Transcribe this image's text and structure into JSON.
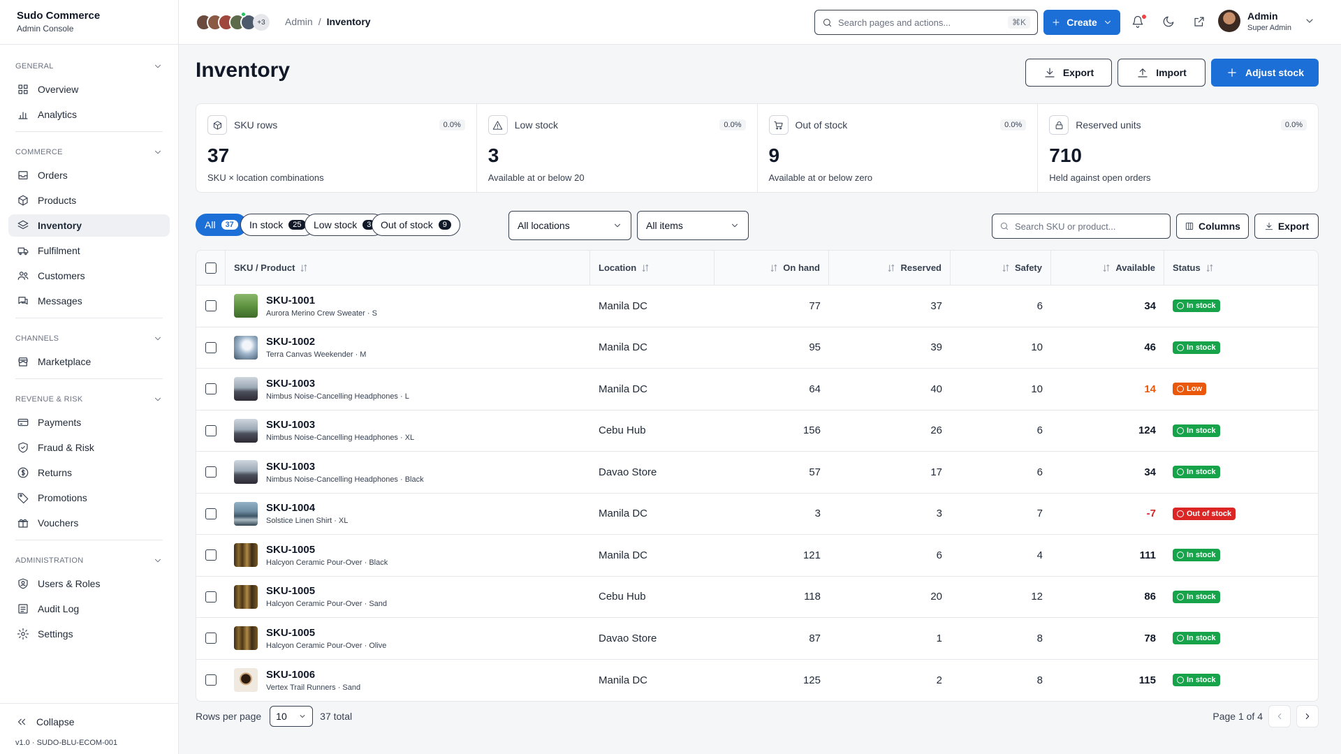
{
  "brand": {
    "name": "Sudo Commerce",
    "subtitle": "Admin Console"
  },
  "sidebar": {
    "sections": [
      {
        "title": "GENERAL",
        "items": [
          {
            "label": "Overview",
            "icon": "grid-icon"
          },
          {
            "label": "Analytics",
            "icon": "bar-chart-icon"
          }
        ]
      },
      {
        "title": "COMMERCE",
        "items": [
          {
            "label": "Orders",
            "icon": "inbox-icon"
          },
          {
            "label": "Products",
            "icon": "box-icon"
          },
          {
            "label": "Inventory",
            "icon": "layers-icon",
            "active": true
          },
          {
            "label": "Fulfilment",
            "icon": "truck-icon"
          },
          {
            "label": "Customers",
            "icon": "users-icon"
          },
          {
            "label": "Messages",
            "icon": "messages-icon"
          }
        ]
      },
      {
        "title": "CHANNELS",
        "items": [
          {
            "label": "Marketplace",
            "icon": "store-icon"
          }
        ]
      },
      {
        "title": "REVENUE & RISK",
        "items": [
          {
            "label": "Payments",
            "icon": "credit-card-icon"
          },
          {
            "label": "Fraud & Risk",
            "icon": "shield-icon"
          },
          {
            "label": "Returns",
            "icon": "dollar-circle-icon"
          },
          {
            "label": "Promotions",
            "icon": "tag-icon"
          },
          {
            "label": "Vouchers",
            "icon": "gift-icon"
          }
        ]
      },
      {
        "title": "ADMINISTRATION",
        "items": [
          {
            "label": "Users & Roles",
            "icon": "user-shield-icon"
          },
          {
            "label": "Audit Log",
            "icon": "list-icon"
          },
          {
            "label": "Settings",
            "icon": "gear-icon"
          }
        ]
      }
    ],
    "collapse_label": "Collapse",
    "version": "v1.0 · SUDO-BLU-ECOM-001"
  },
  "topbar": {
    "avatars_more": "+3",
    "breadcrumb": [
      "Admin",
      "Inventory"
    ],
    "search_placeholder": "Search pages and actions...",
    "search_shortcut": "⌘K",
    "create_label": "Create",
    "user": {
      "name": "Admin",
      "role": "Super Admin"
    }
  },
  "page": {
    "title": "Inventory",
    "actions": {
      "export": "Export",
      "import": "Import",
      "adjust": "Adjust stock"
    }
  },
  "stats": [
    {
      "label": "SKU rows",
      "pct": "0.0%",
      "value": "37",
      "sub": "SKU × location combinations",
      "icon": "cube-icon"
    },
    {
      "label": "Low stock",
      "pct": "0.0%",
      "value": "3",
      "sub": "Available at or below 20",
      "icon": "warning-icon"
    },
    {
      "label": "Out of stock",
      "pct": "0.0%",
      "value": "9",
      "sub": "Available at or below zero",
      "icon": "cart-icon"
    },
    {
      "label": "Reserved units",
      "pct": "0.0%",
      "value": "710",
      "sub": "Held against open orders",
      "icon": "lock-icon"
    }
  ],
  "filters": {
    "chips": [
      {
        "label": "All",
        "count": "37",
        "active": true
      },
      {
        "label": "In stock",
        "count": "25"
      },
      {
        "label": "Low stock",
        "count": "3"
      },
      {
        "label": "Out of stock",
        "count": "9"
      }
    ],
    "location": "All locations",
    "items": "All items",
    "search_placeholder": "Search SKU or product...",
    "columns_label": "Columns",
    "export_label": "Export"
  },
  "table": {
    "headers": {
      "sku": "SKU / Product",
      "location": "Location",
      "on_hand": "On hand",
      "reserved": "Reserved",
      "safety": "Safety",
      "available": "Available",
      "status": "Status"
    },
    "rows": [
      {
        "sku": "SKU-1001",
        "product": "Aurora Merino Crew Sweater · S",
        "location": "Manila DC",
        "on_hand": "77",
        "reserved": "37",
        "safety": "6",
        "available": "34",
        "status": "In stock",
        "state": "ok",
        "thumb": "green"
      },
      {
        "sku": "SKU-1002",
        "product": "Terra Canvas Weekender · M",
        "location": "Manila DC",
        "on_hand": "95",
        "reserved": "39",
        "safety": "10",
        "available": "46",
        "status": "In stock",
        "state": "ok",
        "thumb": "sky"
      },
      {
        "sku": "SKU-1003",
        "product": "Nimbus Noise-Cancelling Headphones · L",
        "location": "Manila DC",
        "on_hand": "64",
        "reserved": "40",
        "safety": "10",
        "available": "14",
        "status": "Low",
        "state": "low",
        "thumb": "mountain"
      },
      {
        "sku": "SKU-1003",
        "product": "Nimbus Noise-Cancelling Headphones · XL",
        "location": "Cebu Hub",
        "on_hand": "156",
        "reserved": "26",
        "safety": "6",
        "available": "124",
        "status": "In stock",
        "state": "ok",
        "thumb": "mountain"
      },
      {
        "sku": "SKU-1003",
        "product": "Nimbus Noise-Cancelling Headphones · Black",
        "location": "Davao Store",
        "on_hand": "57",
        "reserved": "17",
        "safety": "6",
        "available": "34",
        "status": "In stock",
        "state": "ok",
        "thumb": "mountain"
      },
      {
        "sku": "SKU-1004",
        "product": "Solstice Linen Shirt · XL",
        "location": "Manila DC",
        "on_hand": "3",
        "reserved": "3",
        "safety": "7",
        "available": "-7",
        "status": "Out of stock",
        "state": "out",
        "thumb": "lake"
      },
      {
        "sku": "SKU-1005",
        "product": "Halcyon Ceramic Pour-Over · Black",
        "location": "Manila DC",
        "on_hand": "121",
        "reserved": "6",
        "safety": "4",
        "available": "111",
        "status": "In stock",
        "state": "ok",
        "thumb": "forest"
      },
      {
        "sku": "SKU-1005",
        "product": "Halcyon Ceramic Pour-Over · Sand",
        "location": "Cebu Hub",
        "on_hand": "118",
        "reserved": "20",
        "safety": "12",
        "available": "86",
        "status": "In stock",
        "state": "ok",
        "thumb": "forest"
      },
      {
        "sku": "SKU-1005",
        "product": "Halcyon Ceramic Pour-Over · Olive",
        "location": "Davao Store",
        "on_hand": "87",
        "reserved": "1",
        "safety": "8",
        "available": "78",
        "status": "In stock",
        "state": "ok",
        "thumb": "forest"
      },
      {
        "sku": "SKU-1006",
        "product": "Vertex Trail Runners · Sand",
        "location": "Manila DC",
        "on_hand": "125",
        "reserved": "2",
        "safety": "8",
        "available": "115",
        "status": "In stock",
        "state": "ok",
        "thumb": "cup"
      }
    ]
  },
  "pagination": {
    "rows_per_page_label": "Rows per page",
    "rows_per_page": "10",
    "total": "37 total",
    "page_info": "Page 1 of 4"
  },
  "colors": {
    "accent": "#1d6fd8",
    "ok": "#16a34a",
    "low": "#ea580c",
    "out": "#dc2626"
  }
}
